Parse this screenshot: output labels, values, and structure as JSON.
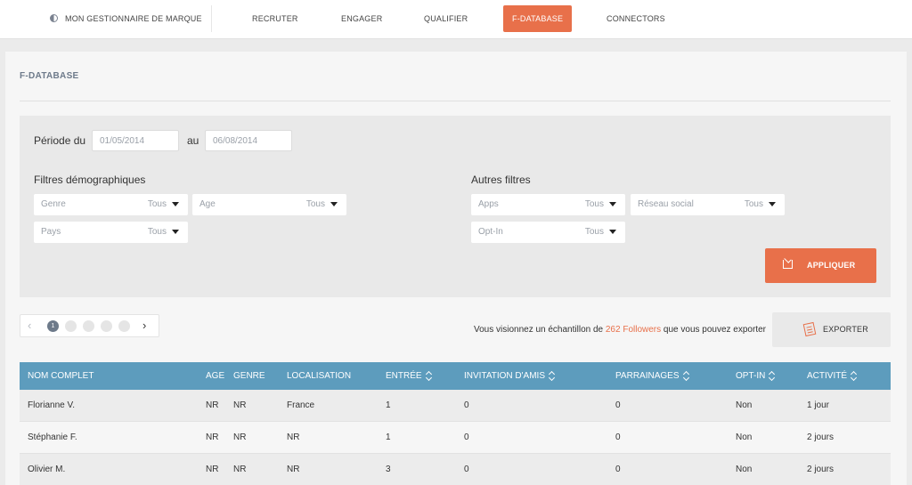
{
  "nav": {
    "brand": "MON GESTIONNAIRE DE MARQUE",
    "items": [
      "RECRUTER",
      "ENGAGER",
      "QUALIFIER",
      "F-DATABASE",
      "CONNECTORS"
    ],
    "active": "F-DATABASE"
  },
  "page": {
    "title": "F-DATABASE"
  },
  "filters": {
    "period_label": "Période du",
    "date_from": "01/05/2014",
    "to_label": "au",
    "date_to": "06/08/2014",
    "demo_title": "Filtres démographiques",
    "other_title": "Autres filtres",
    "genre": {
      "label": "Genre",
      "value": "Tous"
    },
    "age": {
      "label": "Age",
      "value": "Tous"
    },
    "pays": {
      "label": "Pays",
      "value": "Tous"
    },
    "apps": {
      "label": "Apps",
      "value": "Tous"
    },
    "reseau": {
      "label": "Réseau social",
      "value": "Tous"
    },
    "optin": {
      "label": "Opt-In",
      "value": "Tous"
    },
    "apply_label": "APPLIQUER"
  },
  "pagination": {
    "current": "1",
    "prev": "‹",
    "next": "›"
  },
  "sample": {
    "prefix": "Vous visionnez un échantillon de ",
    "highlight": "262 Followers",
    "suffix": " que vous pouvez exporter"
  },
  "export_label": "EXPORTER",
  "table": {
    "headers": {
      "nom": "NOM COMPLET",
      "age": "AGE",
      "genre": "GENRE",
      "loc": "LOCALISATION",
      "entree": "ENTRÉE",
      "invit": "INVITATION D'AMIS",
      "parr": "PARRAINAGES",
      "optin": "OPT-IN",
      "activite": "ACTIVITÉ"
    },
    "rows": [
      {
        "nom": "Florianne V.",
        "age": "NR",
        "genre": "NR",
        "loc": "France",
        "entree": "1",
        "invit": "0",
        "parr": "0",
        "optin": "Non",
        "activite": "1 jour"
      },
      {
        "nom": "Stéphanie F.",
        "age": "NR",
        "genre": "NR",
        "loc": "NR",
        "entree": "1",
        "invit": "0",
        "parr": "0",
        "optin": "Non",
        "activite": "2 jours"
      },
      {
        "nom": "Olivier M.",
        "age": "NR",
        "genre": "NR",
        "loc": "NR",
        "entree": "3",
        "invit": "0",
        "parr": "0",
        "optin": "Non",
        "activite": "2 jours"
      }
    ]
  },
  "colors": {
    "accent": "#e8704a",
    "table_header": "#5d9cbd",
    "title": "#6d7a8a"
  }
}
